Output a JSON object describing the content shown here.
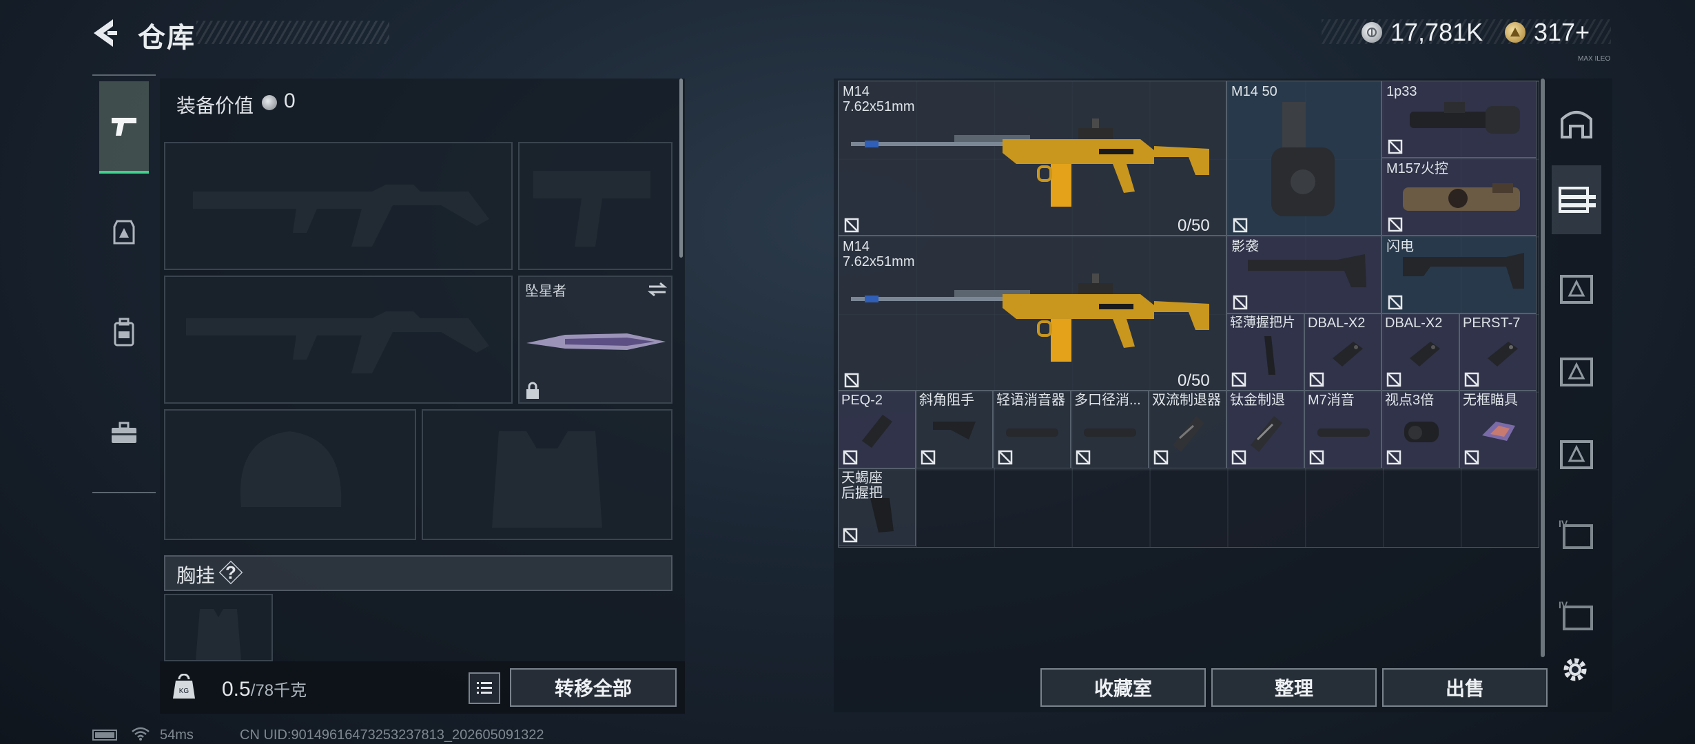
{
  "header": {
    "title": "仓库",
    "silver_amount": "17,781K",
    "gold_amount": "317+",
    "tiny_note": "MAX ILEO"
  },
  "left_panel": {
    "equip_value_label": "装备价值",
    "equip_value": "0",
    "melee_name": "坠星者",
    "chest_label": "胸挂",
    "chest_help": "?",
    "weight_value": "0.5",
    "weight_max": "/78千克",
    "transfer_all": "转移全部"
  },
  "grid": {
    "rifle1": {
      "name": "M14",
      "caliber": "7.62x51mm",
      "ammo": "0/50"
    },
    "rifle2": {
      "name": "M14",
      "caliber": "7.62x51mm",
      "ammo": "0/50"
    },
    "items": [
      {
        "id": "m14-50",
        "label": "M14 50"
      },
      {
        "id": "1p33",
        "label": "1p33"
      },
      {
        "id": "m157",
        "label": "M157火控"
      },
      {
        "id": "yingxi",
        "label": "影袭"
      },
      {
        "id": "shandian",
        "label": "闪电"
      },
      {
        "id": "qingbo",
        "label": "轻薄握把片"
      },
      {
        "id": "dbal1",
        "label": "DBAL-X2"
      },
      {
        "id": "dbal2",
        "label": "DBAL-X2"
      },
      {
        "id": "perst",
        "label": "PERST-7"
      },
      {
        "id": "peq",
        "label": "PEQ-2"
      },
      {
        "id": "xiejiao",
        "label": "斜角阻手"
      },
      {
        "id": "qingyu",
        "label": "轻语消音器"
      },
      {
        "id": "duokou",
        "label": "多口径消..."
      },
      {
        "id": "shuangliu",
        "label": "双流制退器"
      },
      {
        "id": "taijin",
        "label": "钛金制退"
      },
      {
        "id": "m7",
        "label": "M7消音"
      },
      {
        "id": "shidian",
        "label": "视点3倍"
      },
      {
        "id": "wukuang",
        "label": "无框瞄具"
      },
      {
        "id": "tianxie",
        "label": "天蝎座后握把"
      }
    ]
  },
  "right_buttons": {
    "collection": "收藏室",
    "organize": "整理",
    "sell": "出售"
  },
  "status_bar": {
    "ping": "54ms",
    "uid": "CN UID:90149616473253237813_202605091322"
  },
  "colors": {
    "active_tab_accent": "#3fd28c",
    "purple_rarity": "#363850",
    "blue_rarity": "#2c4054"
  }
}
